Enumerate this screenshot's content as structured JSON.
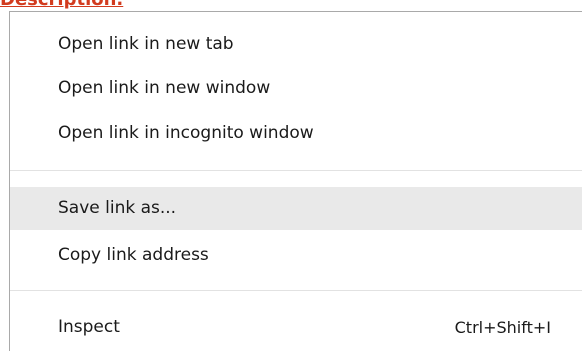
{
  "background": {
    "link_text": "Description."
  },
  "context_menu": {
    "items": [
      {
        "label": "Open link in new tab",
        "shortcut": ""
      },
      {
        "label": "Open link in new window",
        "shortcut": ""
      },
      {
        "label": "Open link in incognito window",
        "shortcut": ""
      },
      {
        "label": "Save link as...",
        "shortcut": "",
        "highlighted": true
      },
      {
        "label": "Copy link address",
        "shortcut": ""
      },
      {
        "label": "Inspect",
        "shortcut": "Ctrl+Shift+I"
      }
    ]
  },
  "colors": {
    "link": "#d23b1e",
    "highlight": "#e9e9e9",
    "border": "#a9a9a9",
    "separator": "#e2e2e2"
  }
}
